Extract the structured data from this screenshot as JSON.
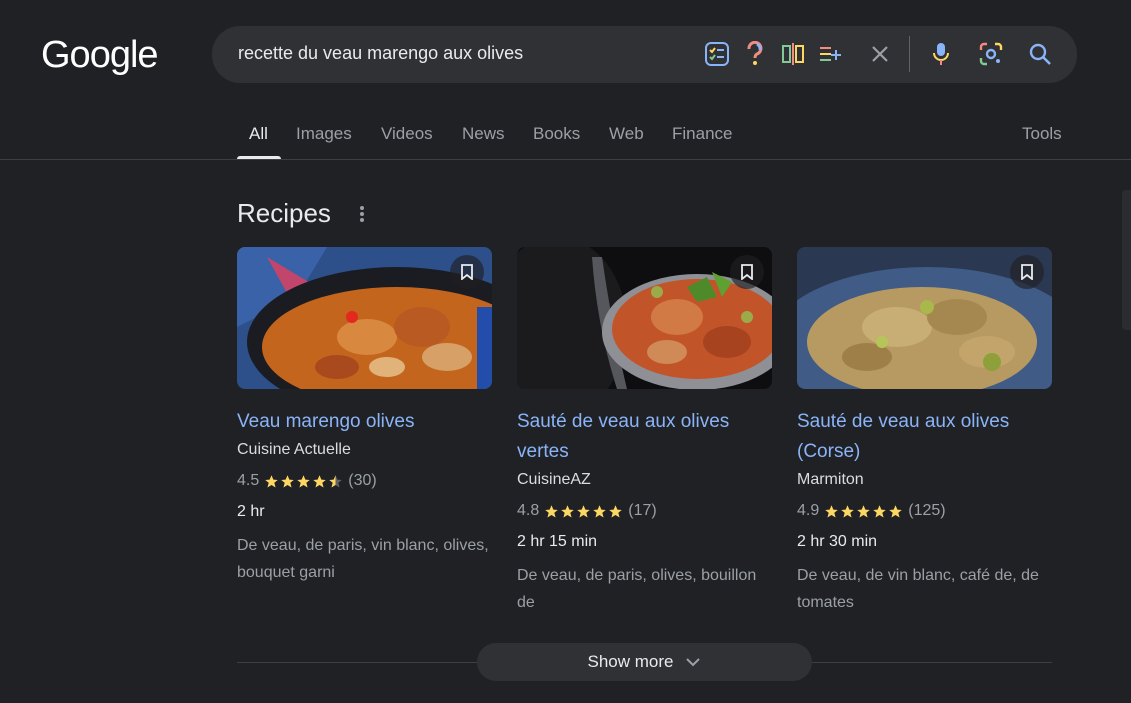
{
  "logo": "Google",
  "search": {
    "query": "recette du veau marengo aux olives",
    "icons": [
      "checklist-icon",
      "question-icon",
      "compare-icon",
      "add-list-icon",
      "close-icon",
      "mic-icon",
      "lens-icon",
      "search-icon"
    ]
  },
  "tabs": [
    {
      "label": "All",
      "active": true
    },
    {
      "label": "Images"
    },
    {
      "label": "Videos"
    },
    {
      "label": "News"
    },
    {
      "label": "Books"
    },
    {
      "label": "Web"
    },
    {
      "label": "Finance"
    }
  ],
  "tools_label": "Tools",
  "section_title": "Recipes",
  "recipes": [
    {
      "title": "Veau marengo olives",
      "source": "Cuisine Actuelle",
      "rating": "4.5",
      "stars": 4.5,
      "reviews": "(30)",
      "time": "2 hr",
      "ingredients": "De veau, de paris, vin blanc, olives, bouquet garni"
    },
    {
      "title": "Sauté de veau aux olives vertes",
      "source": "CuisineAZ",
      "rating": "4.8",
      "stars": 5,
      "reviews": "(17)",
      "time": "2 hr 15 min",
      "ingredients": "De veau, de paris, olives, bouillon de"
    },
    {
      "title": "Sauté de veau aux olives (Corse)",
      "source": "Marmiton",
      "rating": "4.9",
      "stars": 5,
      "reviews": "(125)",
      "time": "2 hr 30 min",
      "ingredients": "De veau, de vin blanc, café de, de tomates"
    }
  ],
  "show_more_label": "Show more",
  "colors": {
    "background": "#202124",
    "link": "#8ab4f8",
    "star": "#fdd663"
  }
}
